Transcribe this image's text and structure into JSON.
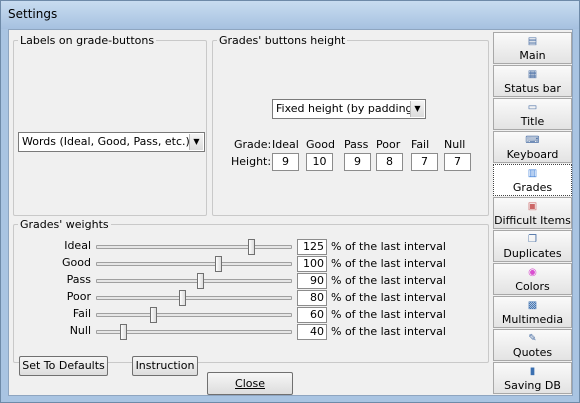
{
  "window": {
    "title": "Settings"
  },
  "labels_group": {
    "legend": "Labels on grade-buttons",
    "select_value": "Words (Ideal, Good, Pass, etc.)"
  },
  "height_group": {
    "legend": "Grades' buttons height",
    "mode_value": "Fixed height (by padding)",
    "grade_label": "Grade:",
    "height_label": "Height:",
    "grades": [
      {
        "name": "Ideal",
        "height": "9"
      },
      {
        "name": "Good",
        "height": "10"
      },
      {
        "name": "Pass",
        "height": "9"
      },
      {
        "name": "Poor",
        "height": "8"
      },
      {
        "name": "Fail",
        "height": "7"
      },
      {
        "name": "Null",
        "height": "7"
      }
    ]
  },
  "weights_group": {
    "legend": "Grades' weights",
    "suffix": "% of the last interval",
    "rows": [
      {
        "name": "Ideal",
        "value": "125",
        "level": 0.79
      },
      {
        "name": "Good",
        "value": "100",
        "level": 0.62
      },
      {
        "name": "Pass",
        "value": "90",
        "level": 0.53
      },
      {
        "name": "Poor",
        "value": "80",
        "level": 0.44
      },
      {
        "name": "Fail",
        "value": "60",
        "level": 0.29
      },
      {
        "name": "Null",
        "value": "40",
        "level": 0.14
      }
    ],
    "set_defaults": "Set To Defaults",
    "instruction": "Instruction"
  },
  "close_button": "Close",
  "nav": [
    {
      "label": "Main",
      "icon": "main-icon"
    },
    {
      "label": "Status bar",
      "icon": "status-bar-icon"
    },
    {
      "label": "Title",
      "icon": "title-icon"
    },
    {
      "label": "Keyboard",
      "icon": "keyboard-icon"
    },
    {
      "label": "Grades",
      "icon": "grades-icon",
      "active": true
    },
    {
      "label": "Difficult Items",
      "icon": "difficult-items-icon"
    },
    {
      "label": "Duplicates",
      "icon": "duplicates-icon"
    },
    {
      "label": "Colors",
      "icon": "colors-icon"
    },
    {
      "label": "Multimedia",
      "icon": "multimedia-icon"
    },
    {
      "label": "Quotes",
      "icon": "quotes-icon"
    },
    {
      "label": "Saving DB",
      "icon": "saving-db-icon"
    }
  ]
}
